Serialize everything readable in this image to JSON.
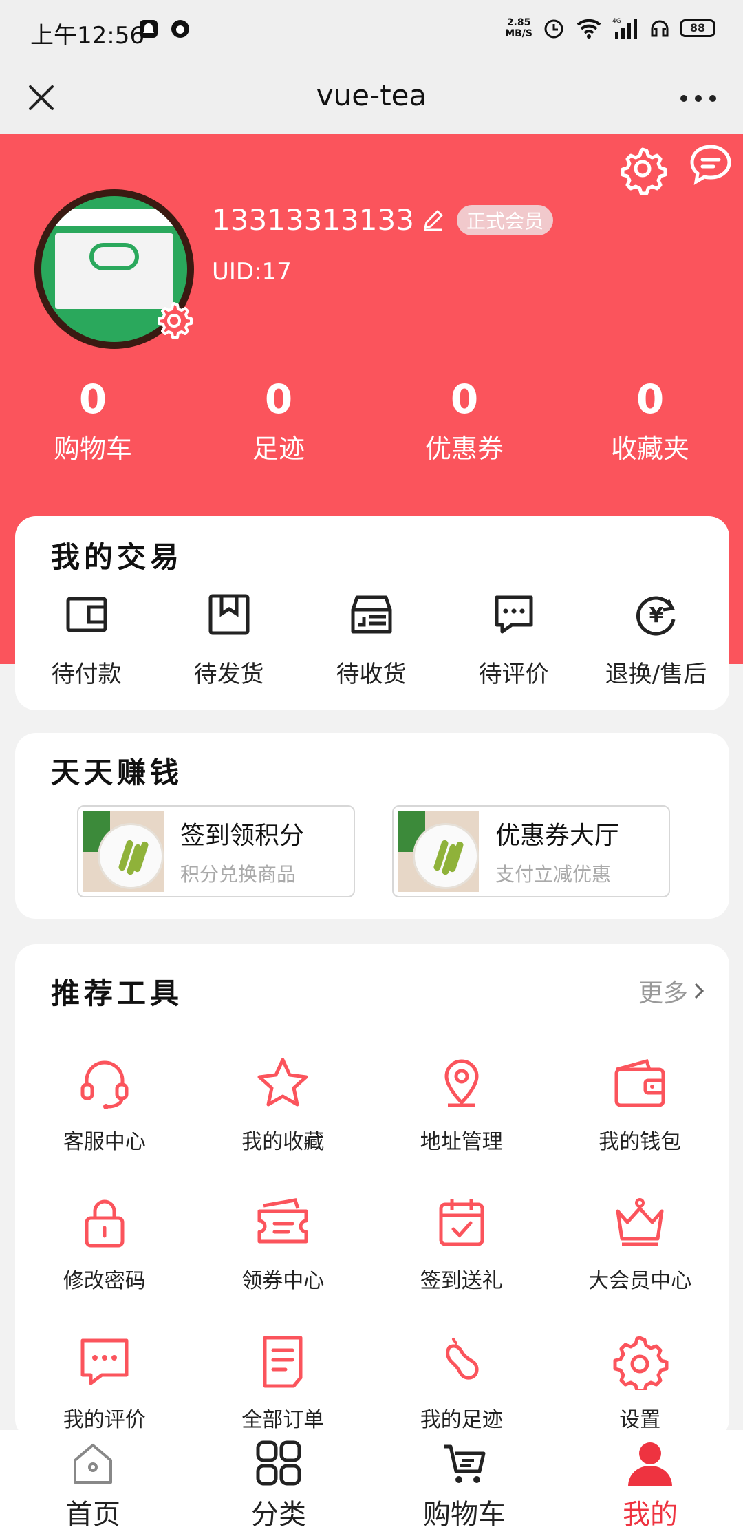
{
  "status_bar": {
    "time": "上午12:56",
    "speed": "2.85",
    "speed_unit": "MB/S",
    "network": "4G",
    "battery": "88"
  },
  "titlebar": {
    "title": "vue-tea"
  },
  "profile": {
    "phone": "13313313133",
    "member_badge": "正式会员",
    "uid": "UID:17"
  },
  "stats": [
    {
      "value": "0",
      "label": "购物车"
    },
    {
      "value": "0",
      "label": "足迹"
    },
    {
      "value": "0",
      "label": "优惠券"
    },
    {
      "value": "0",
      "label": "收藏夹"
    }
  ],
  "trade": {
    "title": "我的交易",
    "items": [
      {
        "label": "待付款",
        "icon": "wallet-icon"
      },
      {
        "label": "待发货",
        "icon": "box-icon"
      },
      {
        "label": "待收货",
        "icon": "delivery-icon"
      },
      {
        "label": "待评价",
        "icon": "comment-icon"
      },
      {
        "label": "退换/售后",
        "icon": "refund-icon"
      }
    ]
  },
  "earn": {
    "title": "天天赚钱",
    "boxes": [
      {
        "title": "签到领积分",
        "subtitle": "积分兑换商品"
      },
      {
        "title": "优惠券大厅",
        "subtitle": "支付立减优惠"
      }
    ]
  },
  "tools": {
    "title": "推荐工具",
    "more": "更多",
    "items": [
      {
        "label": "客服中心",
        "icon": "headset-icon"
      },
      {
        "label": "我的收藏",
        "icon": "star-icon"
      },
      {
        "label": "地址管理",
        "icon": "location-icon"
      },
      {
        "label": "我的钱包",
        "icon": "wallet-icon"
      },
      {
        "label": "修改密码",
        "icon": "lock-icon"
      },
      {
        "label": "领券中心",
        "icon": "coupon-icon"
      },
      {
        "label": "签到送礼",
        "icon": "calendar-check-icon"
      },
      {
        "label": "大会员中心",
        "icon": "crown-icon"
      },
      {
        "label": "我的评价",
        "icon": "comment-icon"
      },
      {
        "label": "全部订单",
        "icon": "document-icon"
      },
      {
        "label": "我的足迹",
        "icon": "footprint-icon"
      },
      {
        "label": "设置",
        "icon": "gear-icon"
      }
    ]
  },
  "tabbar": [
    {
      "label": "首页",
      "icon": "home-icon"
    },
    {
      "label": "分类",
      "icon": "grid-icon"
    },
    {
      "label": "购物车",
      "icon": "cart-icon"
    },
    {
      "label": "我的",
      "icon": "user-icon",
      "active": true
    }
  ],
  "colors": {
    "accent": "#fb545c",
    "tab_active": "#ee3340",
    "text": "#222222"
  }
}
